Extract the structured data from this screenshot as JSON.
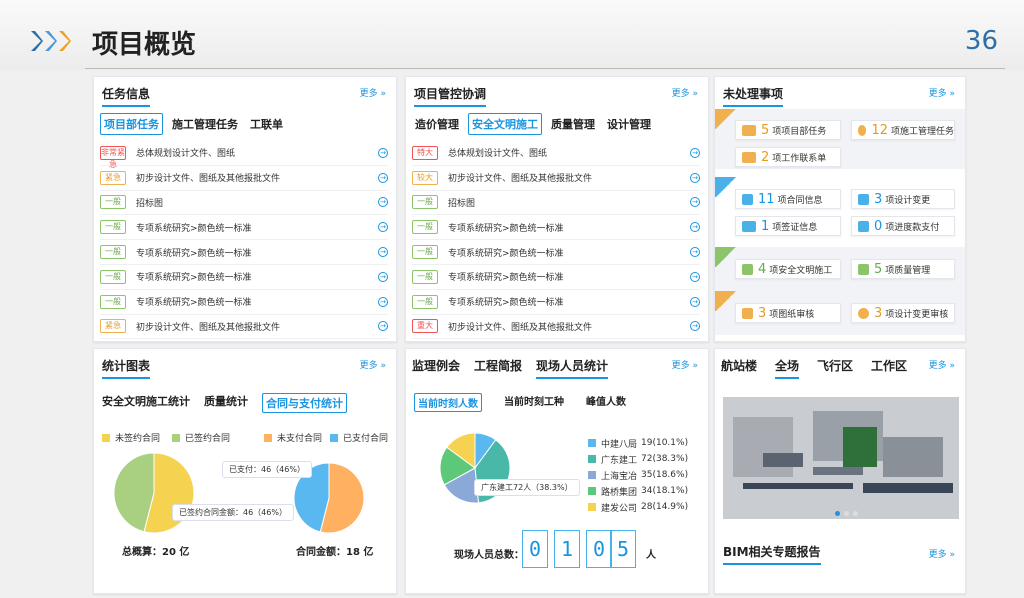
{
  "header": {
    "title": "项目概览",
    "page_number": "36"
  },
  "task": {
    "title": "任务信息",
    "more": "更多 »",
    "tabs": [
      "项目部任务",
      "施工管理任务",
      "工联单"
    ],
    "rows": [
      {
        "badge": "非常紧急",
        "tone": "red",
        "text": "总体规划设计文件、图纸"
      },
      {
        "badge": "紧急",
        "tone": "org",
        "text": "初步设计文件、图纸及其他报批文件"
      },
      {
        "badge": "一般",
        "tone": "grn",
        "text": "招标图"
      },
      {
        "badge": "一般",
        "tone": "grn",
        "text": "专项系统研究>颜色统一标准"
      },
      {
        "badge": "一般",
        "tone": "grn",
        "text": "专项系统研究>颜色统一标准"
      },
      {
        "badge": "一般",
        "tone": "grn",
        "text": "专项系统研究>颜色统一标准"
      },
      {
        "badge": "一般",
        "tone": "grn",
        "text": "专项系统研究>颜色统一标准"
      },
      {
        "badge": "紧急",
        "tone": "org",
        "text": "初步设计文件、图纸及其他报批文件"
      }
    ]
  },
  "control": {
    "title": "项目管控协调",
    "more": "更多 »",
    "tabs": [
      "造价管理",
      "安全文明施工",
      "质量管理",
      "设计管理"
    ],
    "rows": [
      {
        "badge": "特大",
        "tone": "red",
        "text": "总体规划设计文件、图纸"
      },
      {
        "badge": "较大",
        "tone": "org",
        "text": "初步设计文件、图纸及其他报批文件"
      },
      {
        "badge": "一般",
        "tone": "grn",
        "text": "招标图"
      },
      {
        "badge": "一般",
        "tone": "grn",
        "text": "专项系统研究>颜色统一标准"
      },
      {
        "badge": "一般",
        "tone": "grn",
        "text": "专项系统研究>颜色统一标准"
      },
      {
        "badge": "一般",
        "tone": "grn",
        "text": "专项系统研究>颜色统一标准"
      },
      {
        "badge": "一般",
        "tone": "grn",
        "text": "专项系统研究>颜色统一标准"
      },
      {
        "badge": "重大",
        "tone": "red",
        "text": "初步设计文件、图纸及其他报批文件"
      }
    ]
  },
  "todo": {
    "title": "未处理事项",
    "more": "更多 »",
    "items": [
      {
        "n": "5",
        "label": "项项目部任务"
      },
      {
        "n": "12",
        "label": "项施工管理任务"
      },
      {
        "n": "2",
        "label": "项工作联系单"
      },
      {
        "n": "11",
        "label": "项合同信息"
      },
      {
        "n": "3",
        "label": "项设计变更"
      },
      {
        "n": "1",
        "label": "项签证信息"
      },
      {
        "n": "0",
        "label": "项进度款支付"
      },
      {
        "n": "4",
        "label": "项安全文明施工"
      },
      {
        "n": "5",
        "label": "项质量管理"
      },
      {
        "n": "3",
        "label": "项图纸审核"
      },
      {
        "n": "3",
        "label": "项设计变更审核"
      }
    ]
  },
  "stats": {
    "title": "统计图表",
    "more": "更多 »",
    "tabs": [
      "安全文明施工统计",
      "质量统计",
      "合同与支付统计"
    ],
    "legend": [
      "未签约合同",
      "已签约合同",
      "未支付合同",
      "已支付合同"
    ],
    "tip_signed": "已签约合同金额：46（46%）",
    "tip_paid": "已支付：46（46%）",
    "total_budget": "总概算：20 亿",
    "contract_amount": "合同金额：18 亿",
    "colors": {
      "unsigned": "#f5d250",
      "signed": "#a8d080",
      "unpaid": "#ffb060",
      "paid": "#5ab8f0"
    }
  },
  "chart_data": [
    {
      "type": "pie",
      "labels": [
        "未签约合同",
        "已签约合同"
      ],
      "values": [
        54,
        46
      ],
      "colors": [
        "#f5d250",
        "#a8d080"
      ]
    },
    {
      "type": "pie",
      "labels": [
        "未支付合同",
        "已支付合同"
      ],
      "values": [
        54,
        46
      ],
      "colors": [
        "#ffb060",
        "#5ab8f0"
      ]
    },
    {
      "type": "pie",
      "labels": [
        "中建八局",
        "广东建工",
        "上海宝冶",
        "路桥集团",
        "建发公司"
      ],
      "values": [
        19,
        72,
        35,
        34,
        28
      ],
      "percents": [
        "10.1%",
        "38.3%",
        "18.6%",
        "18.1%",
        "14.9%"
      ],
      "colors": [
        "#5ab8f0",
        "#4ab8a8",
        "#8aa8d8",
        "#5cc878",
        "#f5d250"
      ]
    }
  ],
  "supervision": {
    "tabs": [
      "监理例会",
      "工程简报",
      "现场人员统计"
    ],
    "more": "更多 »",
    "subtabs": [
      "当前时刻人数",
      "当前时刻工种",
      "峰值人数"
    ],
    "legend": [
      {
        "name": "中建八局",
        "value": "19(10.1%)"
      },
      {
        "name": "广东建工",
        "value": "72(38.3%)"
      },
      {
        "name": "上海宝冶",
        "value": "35(18.6%)"
      },
      {
        "name": "路桥集团",
        "value": "34(18.1%)"
      },
      {
        "name": "建发公司",
        "value": "28(14.9%)"
      }
    ],
    "tooltip": "广东建工72人（38.3%）",
    "total_label": "现场人员总数：",
    "digits": [
      "0",
      "1",
      "0",
      "5"
    ],
    "unit": "人"
  },
  "terminal": {
    "tabs": [
      "航站楼",
      "全场",
      "飞行区",
      "工作区"
    ],
    "more": "更多 »",
    "report_title": "BIM相关专题报告",
    "report_more": "更多 »"
  }
}
